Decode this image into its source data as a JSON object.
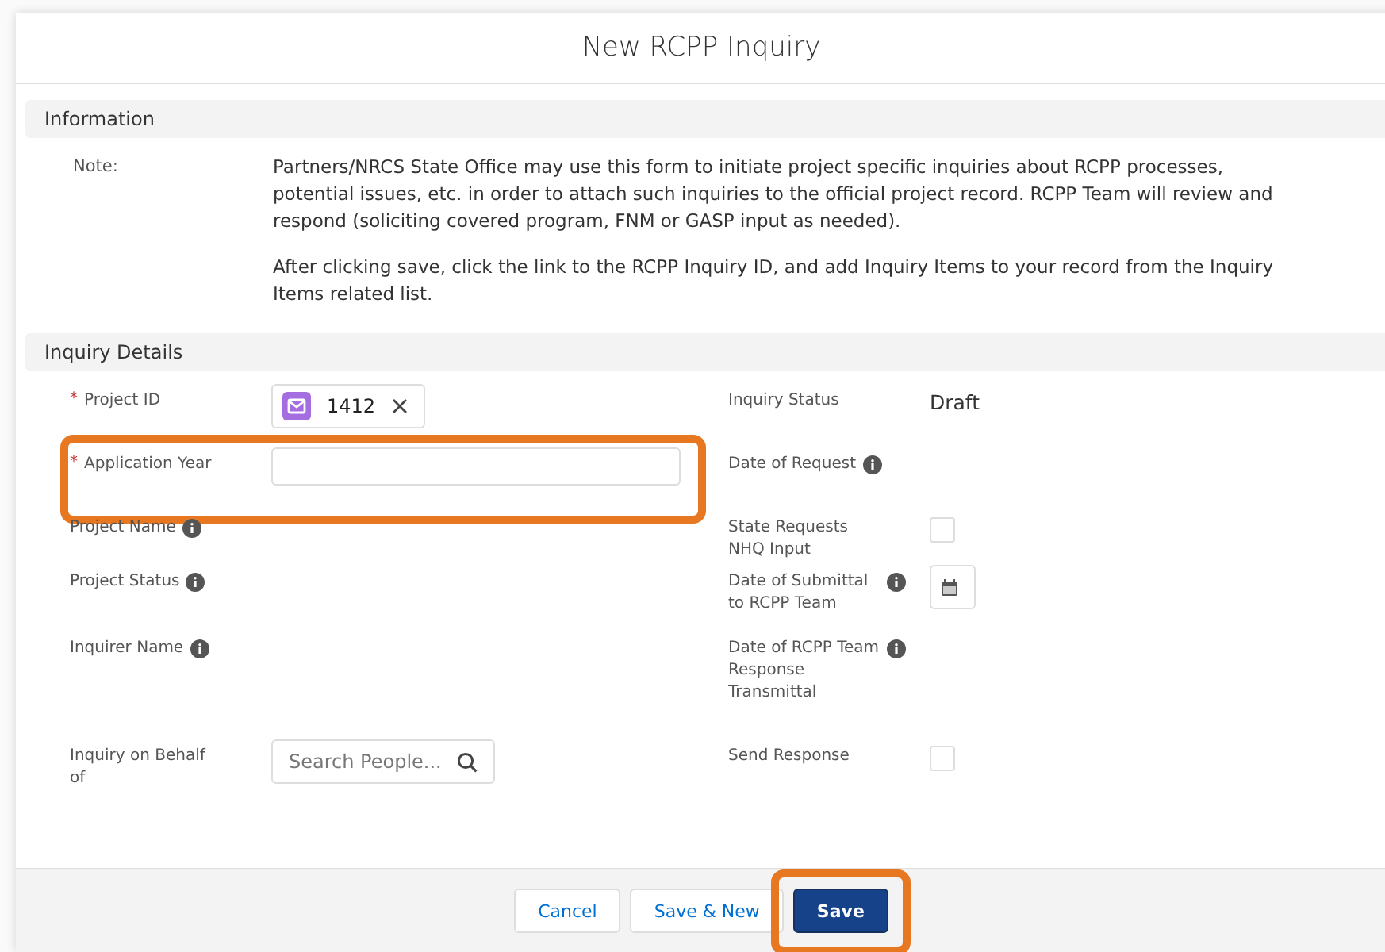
{
  "title": "New RCPP Inquiry",
  "information": {
    "heading": "Information",
    "note_label": "Note:",
    "paragraphs": [
      "Partners/NRCS State Office may use this form to initiate project specific inquiries about RCPP processes, potential issues, etc. in order to attach such inquiries to the official project record. RCPP Team will review and respond (soliciting covered program, FNM or GASP input as needed).",
      "After clicking save, click the link to the RCPP Inquiry ID, and add Inquiry Items to your record from the Inquiry Items related list."
    ]
  },
  "details": {
    "heading": "Inquiry Details",
    "rows": [
      {
        "left": {
          "label": "Project ID",
          "kind": "lookup",
          "required_mark": "*",
          "info": false,
          "value": "1412",
          "highlighted": false
        },
        "right": {
          "label": "Inquiry Status",
          "kind": "readonly",
          "info": false,
          "value": "Draft",
          "highlighted": false
        }
      },
      {
        "left": {
          "label": "Application Year",
          "kind": "text",
          "required_mark": "*",
          "info": false,
          "highlighted": true
        },
        "right": {
          "label": "Date of Request",
          "kind": "readonly",
          "info": true,
          "highlighted": false
        }
      },
      {
        "left": {
          "label": "Project Name",
          "kind": "readonly",
          "info": true,
          "highlighted": false
        },
        "right": {
          "label": "State Requests NHQ Input",
          "kind": "checkbox",
          "info": false,
          "checked": false,
          "highlighted": false
        }
      },
      {
        "left": {
          "label": "Project Status",
          "kind": "readonly",
          "info": true,
          "highlighted": false
        },
        "right": {
          "label": "Date of Submittal to RCPP Team",
          "kind": "date",
          "info": true,
          "highlighted": false
        }
      },
      {
        "left": {
          "label": "Inquirer Name",
          "kind": "readonly",
          "info": true,
          "highlighted": false
        },
        "right": {
          "label": "Date of RCPP Team Response Transmittal",
          "kind": "readonly",
          "info": true,
          "highlighted": false
        }
      },
      {
        "left": {
          "label": "Inquiry on Behalf of",
          "kind": "search",
          "info": false,
          "placeholder": "Search People...",
          "highlighted": false
        },
        "right": {
          "label": "Send Response",
          "kind": "checkbox",
          "info": false,
          "checked": false,
          "highlighted": false
        }
      }
    ]
  },
  "buttons": [
    {
      "label": "Cancel",
      "kind": "neutral",
      "highlighted": false
    },
    {
      "label": "Save & New",
      "kind": "neutral",
      "highlighted": false
    },
    {
      "label": "Save",
      "kind": "brand",
      "highlighted": true
    }
  ]
}
